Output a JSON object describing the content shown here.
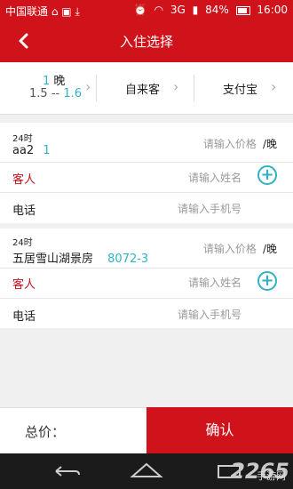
{
  "status": {
    "carrier": "中国联通",
    "network": "3G",
    "battery": "84%",
    "time": "16:00"
  },
  "nav": {
    "title": "入住选择"
  },
  "options": {
    "nights_count": "1",
    "nights_unit": "晚",
    "date_from": "1.5",
    "date_sep": "--",
    "date_to": "1.6",
    "source": "自来客",
    "payment": "支付宝"
  },
  "rooms": [
    {
      "tag": "24时",
      "name": "aa2",
      "number": "1",
      "price_placeholder": "请输入价格",
      "price_unit": "/晚",
      "guest_label": "客人",
      "guest_placeholder": "请输入姓名",
      "phone_label": "电话",
      "phone_placeholder": "请输入手机号"
    },
    {
      "tag": "24时",
      "name": "五居雪山湖景房",
      "number": "8072-3",
      "price_placeholder": "请输入价格",
      "price_unit": "/晚",
      "guest_label": "客人",
      "guest_placeholder": "请输入姓名",
      "phone_label": "电话",
      "phone_placeholder": "请输入手机号"
    }
  ],
  "footer": {
    "total_label": "总价：",
    "confirm_label": "确认"
  },
  "watermark": {
    "brand": "2265",
    "site": "手游网"
  },
  "colors": {
    "primary": "#d0121b",
    "accent": "#2fb3c3"
  }
}
